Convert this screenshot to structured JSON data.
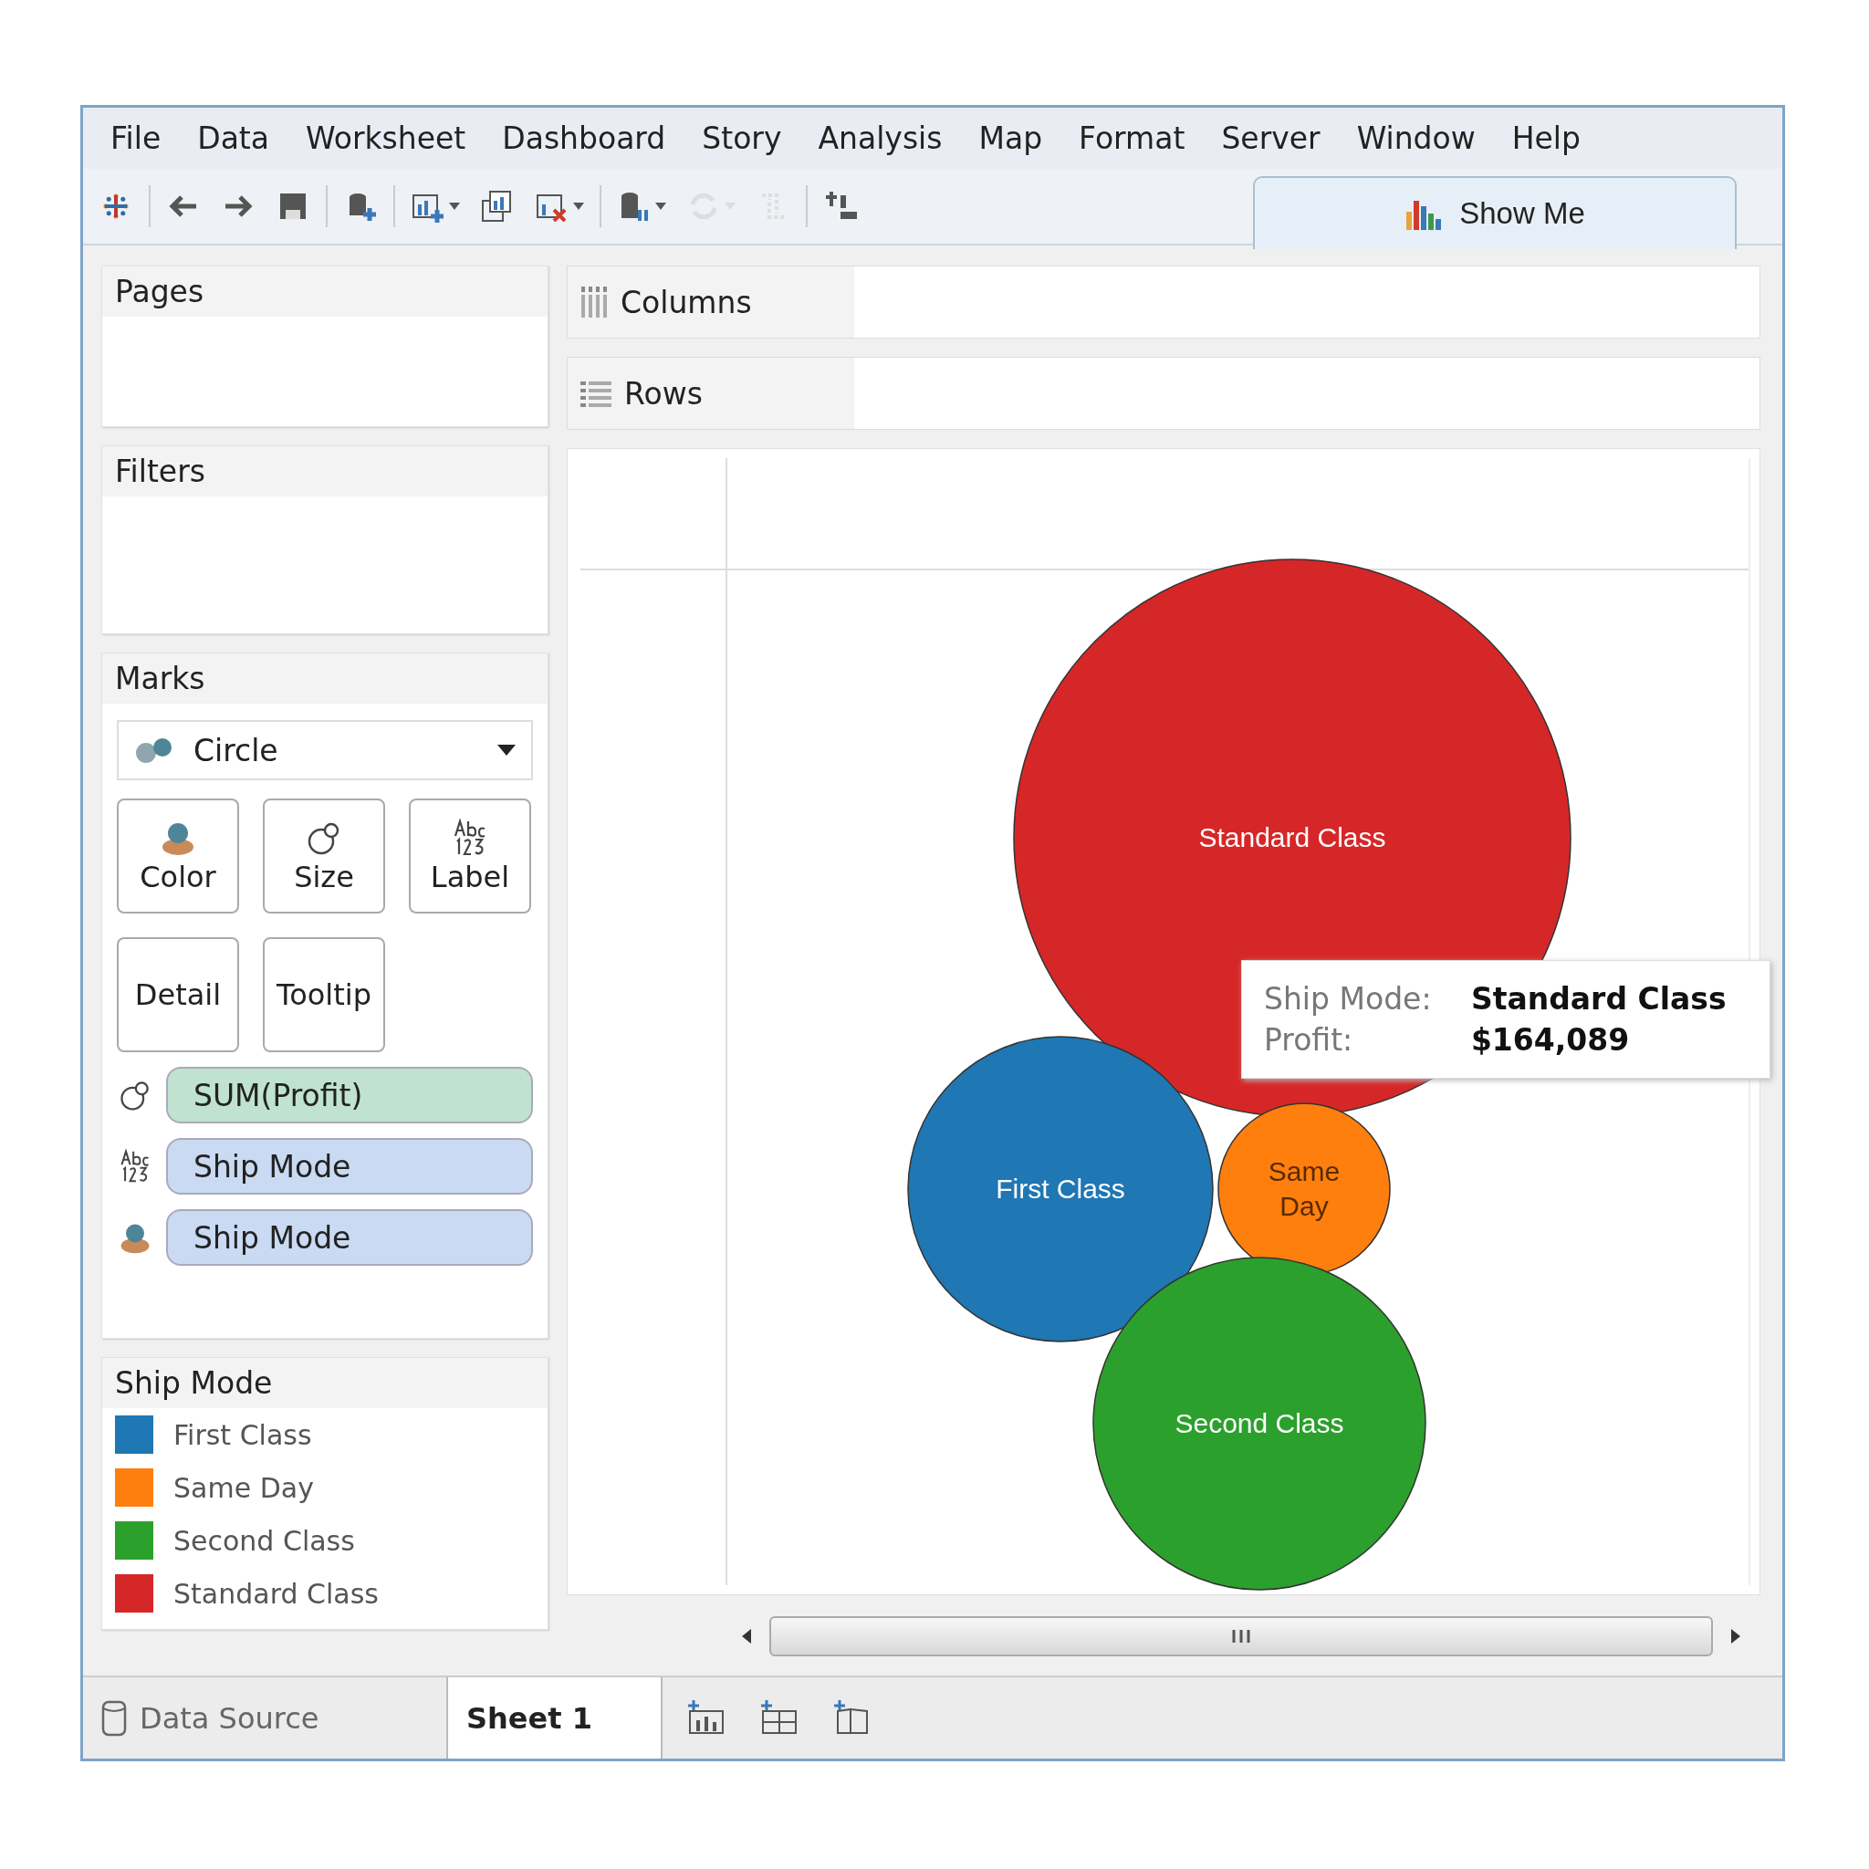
{
  "menu": [
    "File",
    "Data",
    "Worksheet",
    "Dashboard",
    "Story",
    "Analysis",
    "Map",
    "Format",
    "Server",
    "Window",
    "Help"
  ],
  "toolbar": [
    {
      "disabled": false
    },
    {
      "disabled": false
    },
    {
      "disabled": false
    },
    {
      "disabled": false
    },
    {
      "disabled": false
    },
    {
      "disabled": false
    },
    {
      "disabled": false
    },
    {
      "disabled": false
    },
    {
      "disabled": false
    },
    {
      "disabled": true
    },
    {
      "disabled": true
    },
    {
      "disabled": false
    }
  ],
  "show_me": {
    "label": "Show Me"
  },
  "pages": {
    "title": "Pages"
  },
  "filters": {
    "title": "Filters"
  },
  "marks": {
    "title": "Marks",
    "mark_type": "Circle",
    "buttons": [
      "Color",
      "Size",
      "Label",
      "Detail",
      "Tooltip"
    ],
    "pills": [
      {
        "kind": "size",
        "color": "#bfe3cf",
        "label": "SUM(Profit)"
      },
      {
        "kind": "label",
        "color": "#c9daf2",
        "label": "Ship Mode"
      },
      {
        "kind": "color",
        "color": "#c9daf2",
        "label": "Ship Mode"
      }
    ]
  },
  "legend": {
    "title": "Ship Mode",
    "items": [
      {
        "label": "First Class",
        "color": "#1f77b4"
      },
      {
        "label": "Same Day",
        "color": "#ff7f0e"
      },
      {
        "label": "Second Class",
        "color": "#2ca02c"
      },
      {
        "label": "Standard Class",
        "color": "#d62728"
      }
    ]
  },
  "shelves": [
    {
      "kind": "columns",
      "label": "Columns"
    },
    {
      "kind": "rows",
      "label": "Rows"
    }
  ],
  "chart": {
    "bubbles": [
      {
        "label": "Standard Class",
        "color": "#d62728"
      },
      {
        "label": "First Class",
        "color": "#1f77b4"
      },
      {
        "label": "Same Day",
        "color": "#ff7f0e"
      },
      {
        "label": "Second Class",
        "color": "#2ca02c"
      }
    ],
    "tooltip": [
      {
        "field": "Ship Mode:",
        "value": "Standard Class"
      },
      {
        "field": "Profit:",
        "value": "$164,089"
      }
    ]
  },
  "sheet_tabs": [
    {
      "label": "Data Source",
      "kind": "data",
      "selected": false
    },
    {
      "label": "Sheet 1",
      "kind": "sheet",
      "selected": true
    }
  ]
}
